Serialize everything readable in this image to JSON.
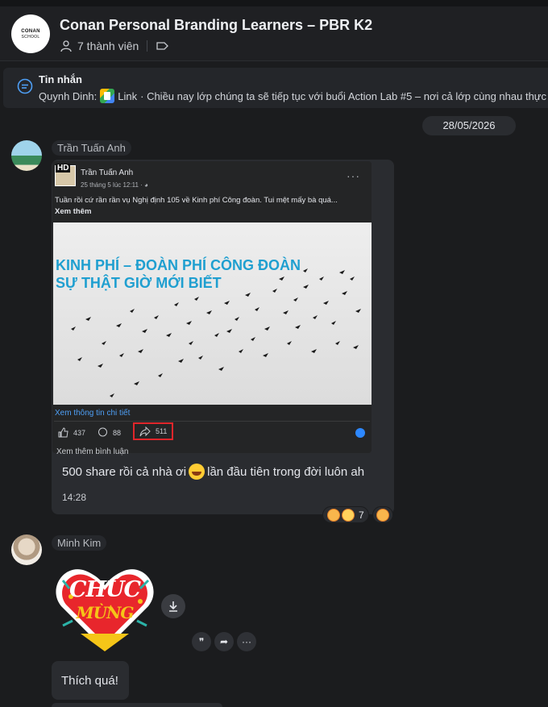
{
  "header": {
    "logo_line1": "CONAN",
    "logo_line2": "SCHOOL",
    "title": "Conan Personal Branding Learners – PBR K2",
    "members": "7 thành viên"
  },
  "pinned": {
    "title": "Tin nhắn",
    "sender": "Quynh Dinh:",
    "link_label": "Link",
    "text": "· Chiều nay lớp chúng ta sẽ tiếp tục với buổi Action Lab #5 – nơi cả lớp cùng nhau thực"
  },
  "date_divider": "28/05/2026",
  "message1": {
    "sender": "Trần Tuấn Anh",
    "fb_card": {
      "hd_tag": "HD",
      "author": "Trần Tuấn Anh",
      "posted": "25 tháng 5 lúc 12:11 · ◕",
      "menu": "···",
      "caption": "Tuần rồi cứ rần rần vụ Nghị định 105 về Kinh phí Công đoàn. Tui mệt mấy bà quá...",
      "see_more": "Xem thêm",
      "image_title_1": "KINH PHÍ – ĐOÀN PHÍ CÔNG ĐOÀN",
      "image_title_2": "SỰ THẬT GIỜ MỚI BIẾT",
      "details_link": "Xem thông tin chi tiết",
      "likes": "437",
      "comments": "88",
      "shares": "511",
      "all_comments": "Xem thêm bình luận"
    },
    "text_before": "500 share rồi cả nhà ơi",
    "text_after": "lần đầu tiên trong đời luôn ah",
    "time": "14:28",
    "reaction_count": "7"
  },
  "message2": {
    "sender": "Minh Kim",
    "sticker_line1": "CHÚC",
    "sticker_line2": "MỪNG",
    "quote_glyph": "❞",
    "share_glyph": "➦",
    "more_glyph": "···"
  },
  "message3": {
    "text": "Thích quá!"
  }
}
